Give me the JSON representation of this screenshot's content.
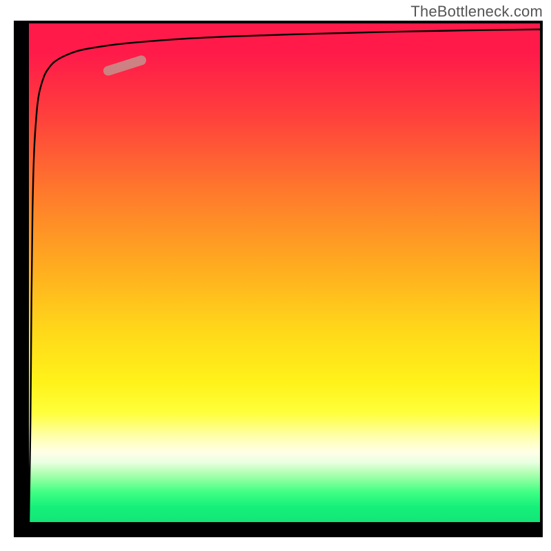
{
  "branding": {
    "text": "TheBottleneck.com"
  },
  "colors": {
    "frame": "#000000",
    "curve": "#000000",
    "marker_fill": "#c98a87",
    "marker_stroke": "#b86f6b"
  },
  "chart_data": {
    "type": "line",
    "title": "",
    "xlabel": "",
    "ylabel": "",
    "xlim": [
      0,
      100
    ],
    "ylim": [
      0,
      100
    ],
    "grid": false,
    "legend": false,
    "series": [
      {
        "name": "curve",
        "x": [
          0,
          0.3,
          0.5,
          0.7,
          1,
          1.5,
          2,
          3,
          4,
          5,
          7,
          10,
          15,
          20,
          30,
          40,
          55,
          70,
          85,
          100
        ],
        "y": [
          0,
          20,
          45,
          62,
          74,
          82,
          86,
          89.5,
          91.2,
          92.3,
          93.5,
          94.6,
          95.5,
          96.1,
          96.9,
          97.4,
          97.9,
          98.3,
          98.6,
          98.8
        ]
      }
    ],
    "marker": {
      "x0": 15.5,
      "y0": 90.5,
      "x1": 22,
      "y1": 92.6,
      "width": 2.0
    },
    "background_gradient": {
      "orientation": "vertical",
      "stops": [
        {
          "pos": 0.0,
          "color": "#ff1a4a"
        },
        {
          "pos": 0.18,
          "color": "#ff3e3d"
        },
        {
          "pos": 0.34,
          "color": "#ff7a2c"
        },
        {
          "pos": 0.5,
          "color": "#ffb01f"
        },
        {
          "pos": 0.62,
          "color": "#ffd91a"
        },
        {
          "pos": 0.78,
          "color": "#ffff3a"
        },
        {
          "pos": 0.86,
          "color": "#ffffe8"
        },
        {
          "pos": 0.9,
          "color": "#b6ffb6"
        },
        {
          "pos": 1.0,
          "color": "#12e677"
        }
      ]
    }
  }
}
